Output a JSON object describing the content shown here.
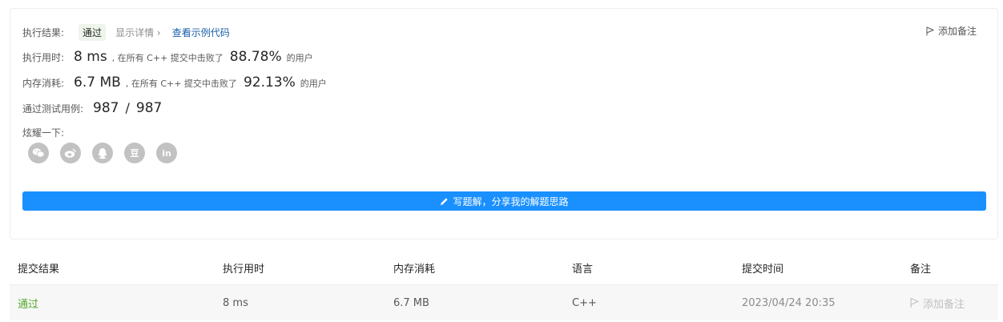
{
  "result": {
    "label": "执行结果:",
    "status": "通过",
    "details_link": "显示详情 ›",
    "example_link": "查看示例代码",
    "note_button": "添加备注"
  },
  "runtime": {
    "label": "执行用时:",
    "value": "8 ms",
    "beat_prefix": ", 在所有 C++ 提交中击败了",
    "percent": "88.78%",
    "suffix": "的用户"
  },
  "memory": {
    "label": "内存消耗:",
    "value": "6.7 MB",
    "beat_prefix": ", 在所有 C++ 提交中击败了",
    "percent": "92.13%",
    "suffix": "的用户"
  },
  "tests": {
    "label": "通过测试用例:",
    "passed": "987",
    "separator": "/",
    "total": "987"
  },
  "share": {
    "label": "炫耀一下:",
    "icons": [
      "wechat-icon",
      "weibo-icon",
      "qq-icon",
      "douban-icon",
      "linkedin-icon"
    ],
    "douban_glyph": "豆",
    "linkedin_glyph": "in"
  },
  "write_button": "写题解，分享我的解题思路",
  "table": {
    "headers": [
      "提交结果",
      "执行用时",
      "内存消耗",
      "语言",
      "提交时间",
      "备注"
    ],
    "rows": [
      {
        "result": "通过",
        "runtime": "8 ms",
        "memory": "6.7 MB",
        "language": "C++",
        "time": "2023/04/24 20:35",
        "note": "添加备注"
      }
    ]
  },
  "colors": {
    "accent": "#1a90ff",
    "success": "#52a82a",
    "link": "#1a5fa8",
    "icon_gray": "#c2c2c2"
  }
}
